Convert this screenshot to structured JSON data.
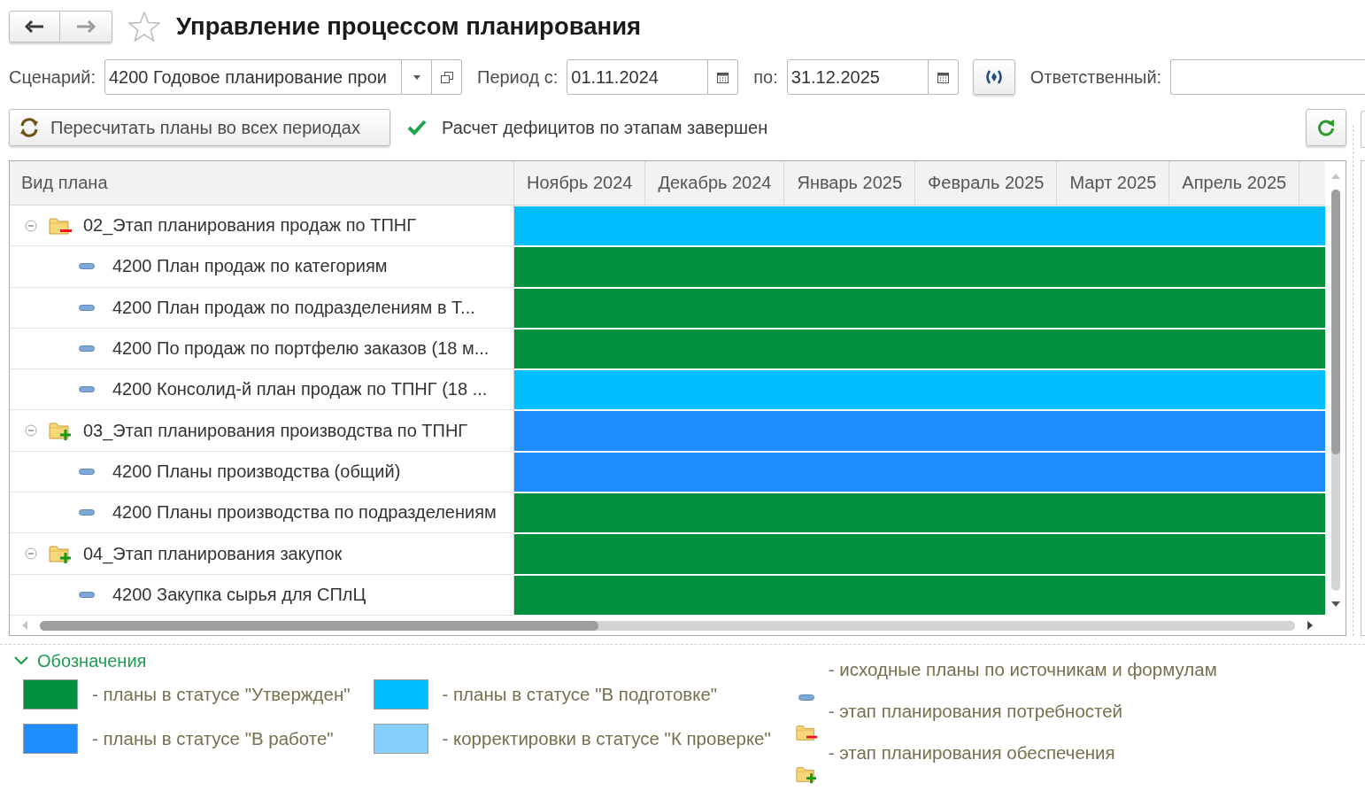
{
  "header": {
    "nav": [
      {
        "kind": "back",
        "disabled": false
      },
      {
        "kind": "forward",
        "disabled": true
      }
    ],
    "favorite": false,
    "title": "Управление процессом планирования"
  },
  "filters": {
    "scenario": {
      "label": "Сценарий:",
      "value": "4200 Годовое планирование прои"
    },
    "period_from": {
      "label": "Период с:",
      "value": "01.11.2024"
    },
    "period_to": {
      "label": "по:",
      "value": "31.12.2025"
    },
    "responsible": {
      "label": "Ответственный:"
    }
  },
  "toolbar": {
    "recalculate_button": "Пересчитать планы во всех периодах",
    "status": "Расчет дефицитов по этапам завершен"
  },
  "table": {
    "columns": [
      "Вид плана",
      "Ноябрь 2024",
      "Декабрь 2024",
      "Январь 2025",
      "Февраль 2025",
      "Март 2025",
      "Апрель 2025"
    ],
    "rows": [
      {
        "kind": "needs_stage",
        "label": "02_Этап планирования продаж по ТПНГ",
        "color": "#00bfff",
        "expanded": true,
        "children": [
          {
            "kind": "source",
            "label": "4200 План продаж по категориям",
            "color": "#00903e"
          },
          {
            "kind": "source",
            "label": "4200 План продаж по подразделениям в Т...",
            "color": "#00903e"
          },
          {
            "kind": "source",
            "label": "4200 По продаж по портфелю заказов (18 м...",
            "color": "#00903e"
          },
          {
            "kind": "source",
            "label": "4200 Консолид-й план продаж по ТПНГ (18 ...",
            "color": "#00bfff"
          }
        ]
      },
      {
        "kind": "supply_stage",
        "label": "03_Этап планирования производства по ТПНГ",
        "color": "#1e8cff",
        "expanded": true,
        "children": [
          {
            "kind": "source",
            "label": "4200 Планы производства (общий)",
            "color": "#1e8cff"
          },
          {
            "kind": "source",
            "label": "4200 Планы производства по подразделениям",
            "color": "#00903e"
          }
        ]
      },
      {
        "kind": "supply_stage",
        "label": "04_Этап планирования закупок",
        "color": "#00903e",
        "expanded": true,
        "children": [
          {
            "kind": "source",
            "label": "4200 Закупка сырья для СПлЦ",
            "color": "#00903e"
          }
        ]
      }
    ]
  },
  "legend": {
    "title": "Обозначения",
    "expanded": true,
    "color_items": [
      {
        "color": "#00903e",
        "text": "- планы в статусе \"Утвержден\""
      },
      {
        "color": "#00bfff",
        "text": "- планы в статусе \"В подготовке\""
      },
      {
        "color": "#1e8cff",
        "text": "- планы в статусе \"В работе\""
      },
      {
        "color": "#87cefa",
        "text": "- корректировки в статусе \"К проверке\""
      }
    ],
    "icon_items": [
      {
        "kind": "source",
        "text": "- исходные планы по источникам и формулам"
      },
      {
        "kind": "needs_stage",
        "text": "- этап планирования потребностей"
      },
      {
        "kind": "supply_stage",
        "text": "- этап планирования обеспечения"
      }
    ]
  }
}
